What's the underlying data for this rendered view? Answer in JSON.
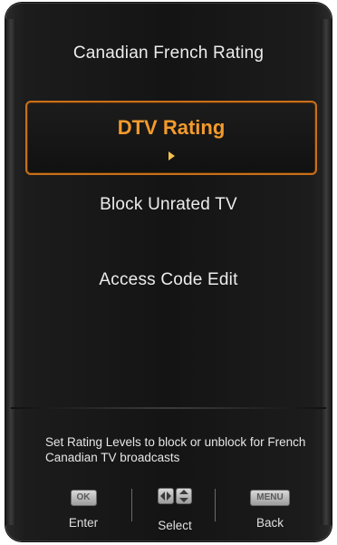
{
  "menu": {
    "title": "Canadian French Rating",
    "items": [
      {
        "label": "DTV Rating",
        "selected": true
      },
      {
        "label": "Block Unrated TV",
        "selected": false
      },
      {
        "label": "Access Code Edit",
        "selected": false
      }
    ]
  },
  "help": {
    "text": "Set Rating Levels to block or unblock for French Canadian TV broadcasts"
  },
  "footer": {
    "ok_key": "OK",
    "ok_label": "Enter",
    "nav_label": "Select",
    "menu_key": "MENU",
    "menu_label": "Back"
  },
  "colors": {
    "accent": "#f39a2c",
    "selection_border": "#c86f1b",
    "panel_bg": "#141414",
    "text": "#ececec"
  },
  "icons": {
    "selection_arrow": "right-arrow-icon",
    "nav_lr": "left-right-arrows-icon",
    "nav_ud": "up-down-arrows-icon"
  }
}
